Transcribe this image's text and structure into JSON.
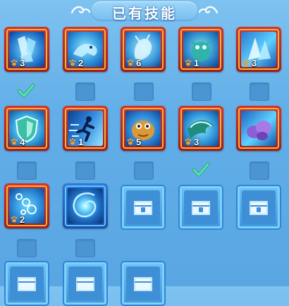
{
  "panel": {
    "title": "已有技能"
  },
  "colors": {
    "background": "#62aee8",
    "frame_red": "#c32a24",
    "frame_gold": "#f0b33a",
    "check_green": "#39c59a",
    "locked_slot": "#3f8fd6"
  },
  "skills": [
    {
      "name": "crystal-shards-skill",
      "count": "3",
      "equipped": true
    },
    {
      "name": "water-wolf-skill",
      "count": "2",
      "equipped": false
    },
    {
      "name": "ice-dragon-skill",
      "count": "6",
      "equipped": false
    },
    {
      "name": "spirit-beast-skill",
      "count": "1",
      "equipped": false
    },
    {
      "name": "ice-crystal-skill",
      "count": "3",
      "equipped": false
    },
    {
      "name": "water-shield-skill",
      "count": "4",
      "equipped": false
    },
    {
      "name": "dash-runner-skill",
      "count": "1",
      "equipped": false
    },
    {
      "name": "golden-armor-skill",
      "count": "5",
      "equipped": false
    },
    {
      "name": "water-wave-skill",
      "count": "3",
      "equipped": true
    },
    {
      "name": "purple-crystal-skill",
      "count": "",
      "equipped": false
    },
    {
      "name": "bubble-stream-skill",
      "count": "2",
      "equipped": false
    },
    {
      "name": "vortex-skill",
      "count": "",
      "equipped": false
    }
  ],
  "icons": {
    "paw": "paw-icon",
    "check": "check-icon",
    "lock": "lock-icon"
  }
}
